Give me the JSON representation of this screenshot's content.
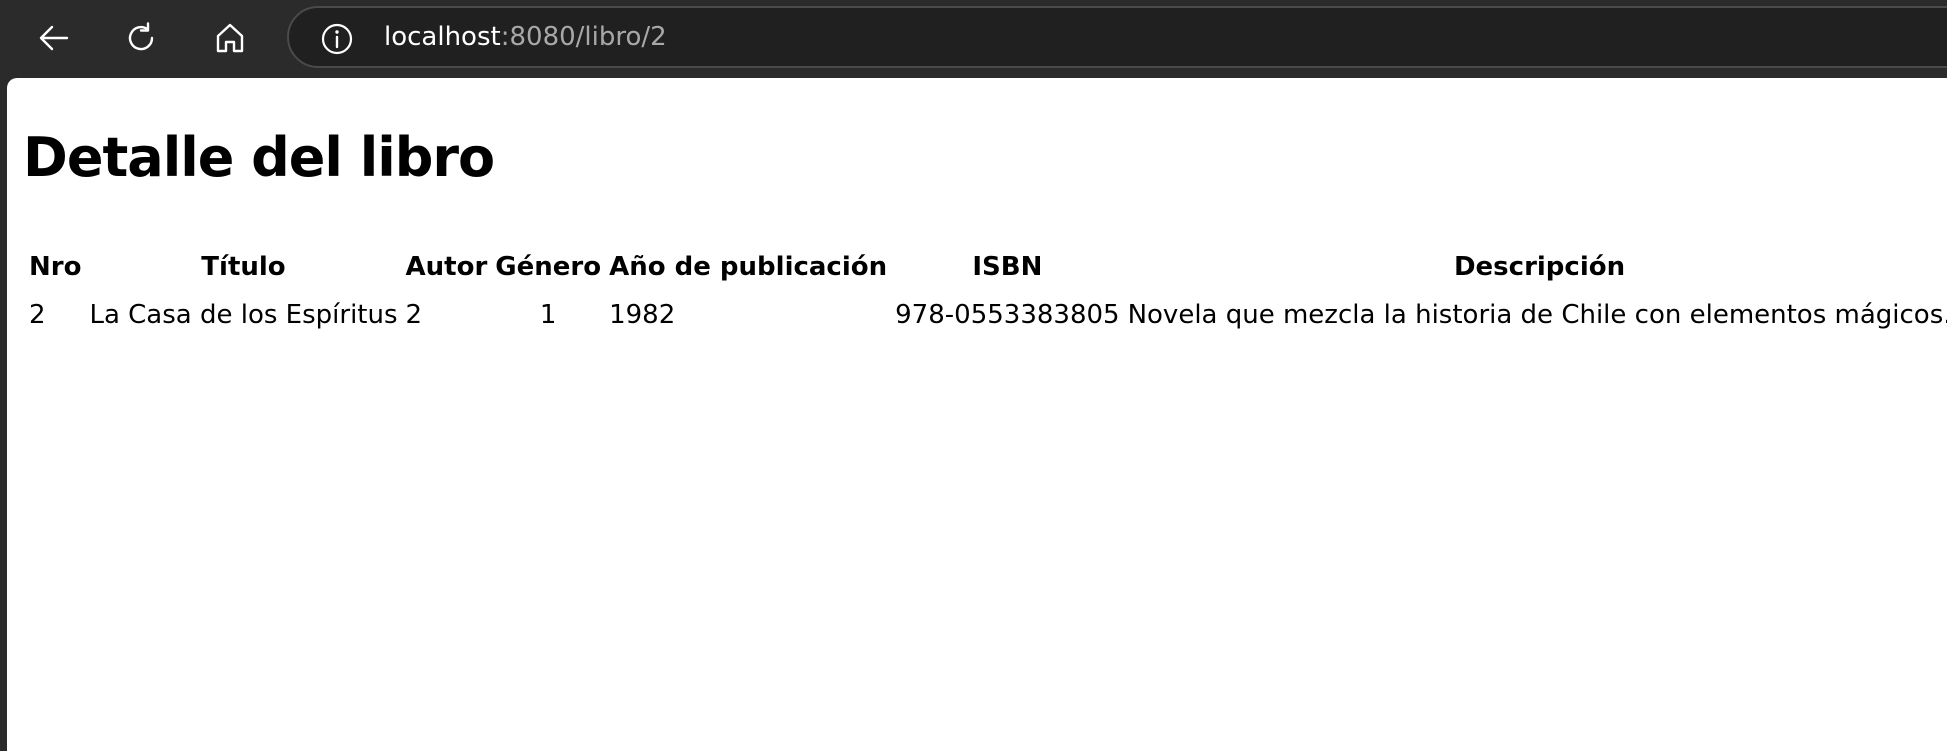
{
  "browser": {
    "url_host": "localhost",
    "url_rest": ":8080/libro/2",
    "icons": {
      "back": "arrow-left-icon",
      "reload": "reload-icon",
      "home": "home-icon",
      "info": "info-icon"
    }
  },
  "page": {
    "title": "Detalle del libro"
  },
  "table": {
    "headers": [
      "Nro",
      "Título",
      "Autor",
      "Género",
      "Año de publicación",
      "ISBN",
      "Descripción"
    ],
    "rows": [
      [
        "2",
        "La Casa de los Espíritus",
        "2",
        "1",
        "1982",
        "978-0553383805",
        "Novela que mezcla la historia de Chile con elementos mágicos."
      ]
    ]
  },
  "colors": {
    "toolbar_bg": "#2b2b2b",
    "address_bg": "#202020",
    "page_bg": "#ffffff",
    "url_host": "#ffffff",
    "url_rest": "#a8a8a8"
  }
}
